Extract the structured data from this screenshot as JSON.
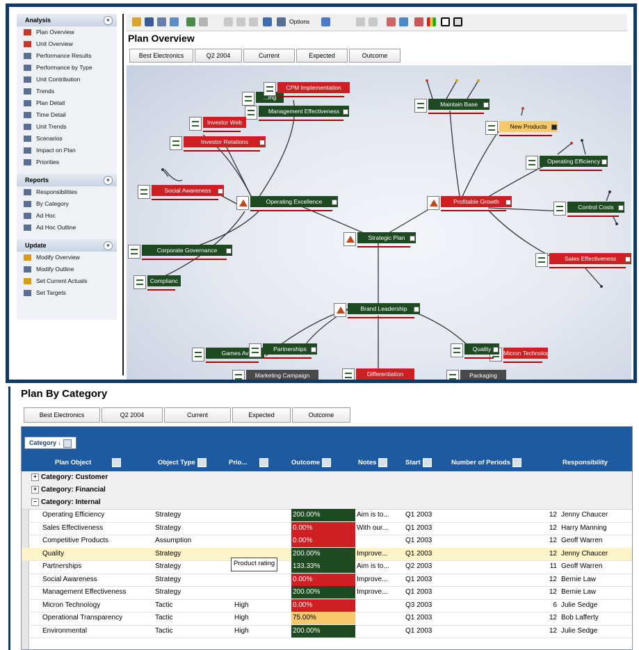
{
  "sidebar": {
    "analysis": {
      "title": "Analysis",
      "items": [
        "Plan Overview",
        "Unit Overview",
        "Performance Results",
        "Performance by Type",
        "Unit Contribution",
        "Trends",
        "Plan Detail",
        "Time Detail",
        "Unit Trends",
        "Scenarios",
        "Impact on Plan",
        "Priorities"
      ]
    },
    "reports": {
      "title": "Reports",
      "items": [
        "Responsibilities",
        "By Category",
        "Ad Hoc",
        "Ad Hoc Outline"
      ]
    },
    "update": {
      "title": "Update",
      "items": [
        "Modify Overview",
        "Modify Outline",
        "Set Current Actuals",
        "Set Targets"
      ]
    },
    "collapse_glyph": "«"
  },
  "toolbar": {
    "options_label": "Options"
  },
  "plan_overview": {
    "title": "Plan Overview",
    "filters": [
      "Best Electronics",
      "Q2 2004",
      "Current",
      "Expected",
      "Outcome"
    ]
  },
  "map_nodes": {
    "strategic_plan": "Strategic Plan",
    "operating_excellence": "Operating Excellence",
    "profitable_growth": "Profitable Growth",
    "brand_leadership": "Brand Leadership",
    "cpm_implementation": "CPM Implementation",
    "behind_cpm": "...ing",
    "management_effectiveness": "Management Effectiveness",
    "investor_web": "Investor Web",
    "investor_relations": "Investor Relations",
    "social_awareness": "Social Awareness",
    "corporate_governance": "Corporate Governance",
    "complianc": "Complianc",
    "maintain_base": "Maintain Base",
    "new_products": "New Products",
    "operating_efficiency": "Operating Efficiency",
    "control_costs": "Control Costs",
    "sales_effectiveness": "Sales Effectiveness",
    "partnerships": "Partnerships",
    "games_av": "Games Av",
    "quality": "Quality",
    "micron_technology": "Micron Technology",
    "marketing_campaign": "Marketing Campaign",
    "differentiation": "Differentiation",
    "packaging": "Packaging"
  },
  "plan_by_category": {
    "title": "Plan By Category",
    "filters": [
      "Best Electronics",
      "Q2 2004",
      "Current",
      "Expected",
      "Outcome"
    ],
    "group_chip": "Category",
    "columns": [
      "Plan Object",
      "Object Type",
      "Prio...",
      "Outcome",
      "Notes",
      "Start",
      "Number of Periods",
      "Responsibility"
    ],
    "categories": [
      "Category: Customer",
      "Category: Financial",
      "Category: Internal"
    ],
    "rows": [
      {
        "object": "Operating Efficiency",
        "type": "Strategy",
        "priority": "",
        "outcome": "200.00%",
        "status": "green",
        "notes": "Aim is to...",
        "start": "Q1 2003",
        "periods": "12",
        "resp": "Jenny Chaucer"
      },
      {
        "object": "Sales Effectiveness",
        "type": "Strategy",
        "priority": "",
        "outcome": "0.00%",
        "status": "red",
        "notes": "With our...",
        "start": "Q1 2003",
        "periods": "12",
        "resp": "Harry Manning"
      },
      {
        "object": "Competitive Products",
        "type": "Assumption",
        "priority": "",
        "outcome": "0.00%",
        "status": "red",
        "notes": "",
        "start": "Q1 2003",
        "periods": "12",
        "resp": "Geoff Warren"
      },
      {
        "object": "Quality",
        "type": "Strategy",
        "priority": "",
        "outcome": "200.00%",
        "status": "green",
        "notes": "Improve...",
        "start": "Q1 2003",
        "periods": "12",
        "resp": "Jenny Chaucer"
      },
      {
        "object": "Partnerships",
        "type": "Strategy",
        "priority": "",
        "outcome": "133.33%",
        "status": "green",
        "notes": "Aim is to...",
        "start": "Q2 2003",
        "periods": "11",
        "resp": "Geoff Warren"
      },
      {
        "object": "Social Awareness",
        "type": "Strategy",
        "priority": "",
        "outcome": "0.00%",
        "status": "red",
        "notes": "Improve...",
        "start": "Q1 2003",
        "periods": "12",
        "resp": "Bernie Law"
      },
      {
        "object": "Management Effectiveness",
        "type": "Strategy",
        "priority": "",
        "outcome": "200.00%",
        "status": "green",
        "notes": "Improve...",
        "start": "Q1 2003",
        "periods": "12",
        "resp": "Bernie Law"
      },
      {
        "object": "Micron Technology",
        "type": "Tactic",
        "priority": "High",
        "outcome": "0.00%",
        "status": "red",
        "notes": "",
        "start": "Q3 2003",
        "periods": "6",
        "resp": "Julie Sedge"
      },
      {
        "object": "Operational Transparency",
        "type": "Tactic",
        "priority": "High",
        "outcome": "75.00%",
        "status": "yellow",
        "notes": "",
        "start": "Q1 2003",
        "periods": "12",
        "resp": "Bob Lafferty"
      },
      {
        "object": "Environmental",
        "type": "Tactic",
        "priority": "High",
        "outcome": "200.00%",
        "status": "green",
        "notes": "",
        "start": "Q1 2003",
        "periods": "12",
        "resp": "Julie Sedge"
      }
    ],
    "tooltip": "Product rating"
  },
  "colors": {
    "green": "#1e4a22",
    "red": "#cf1f22",
    "yellow": "#f7c96b",
    "header_blue": "#1e5aa0",
    "frame": "#0d3a66"
  }
}
